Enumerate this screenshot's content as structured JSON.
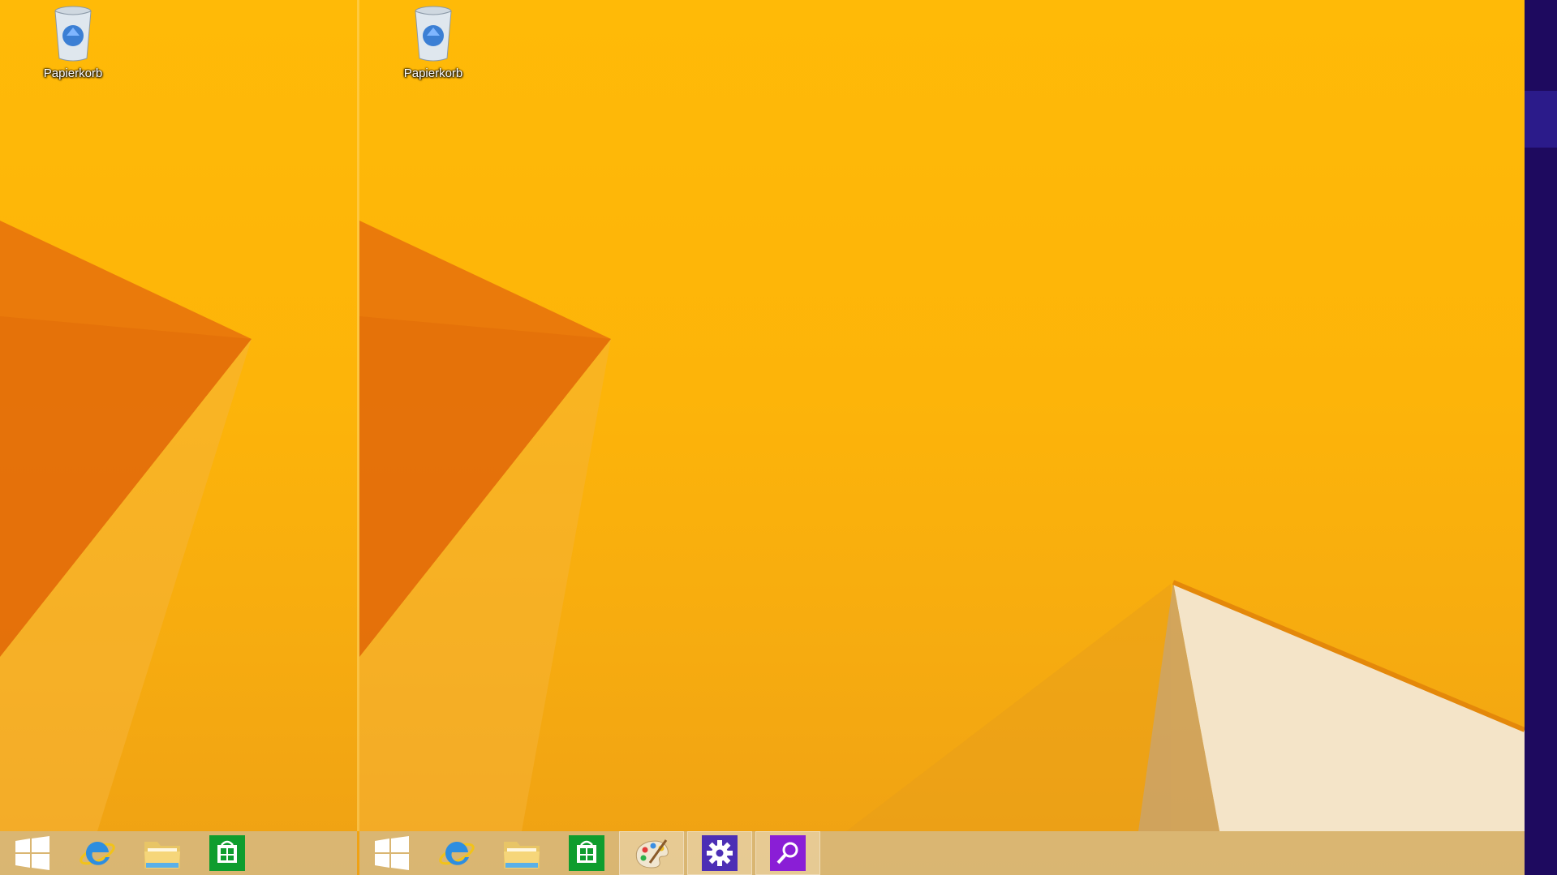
{
  "desktop": {
    "icons": [
      {
        "label": "Papierkorb",
        "icon": "recycle-bin-icon"
      }
    ]
  },
  "taskbar": {
    "pinned": [
      {
        "name": "start",
        "icon": "windows-logo-icon"
      },
      {
        "name": "internet-explorer",
        "icon": "internet-explorer-icon"
      },
      {
        "name": "file-explorer",
        "icon": "folder-icon"
      },
      {
        "name": "store",
        "icon": "store-icon"
      }
    ],
    "running": [
      {
        "name": "paint",
        "icon": "paint-palette-icon"
      },
      {
        "name": "settings",
        "icon": "gear-icon",
        "color": "#4c2fb5"
      },
      {
        "name": "search",
        "icon": "search-icon",
        "color": "#8a1ed6"
      }
    ]
  },
  "colors": {
    "wallpaper": "#fdb409",
    "wallpaper_shadow": "#e8700a",
    "charms_edge": "#1e0a5f",
    "store_green": "#0f9d2e"
  }
}
